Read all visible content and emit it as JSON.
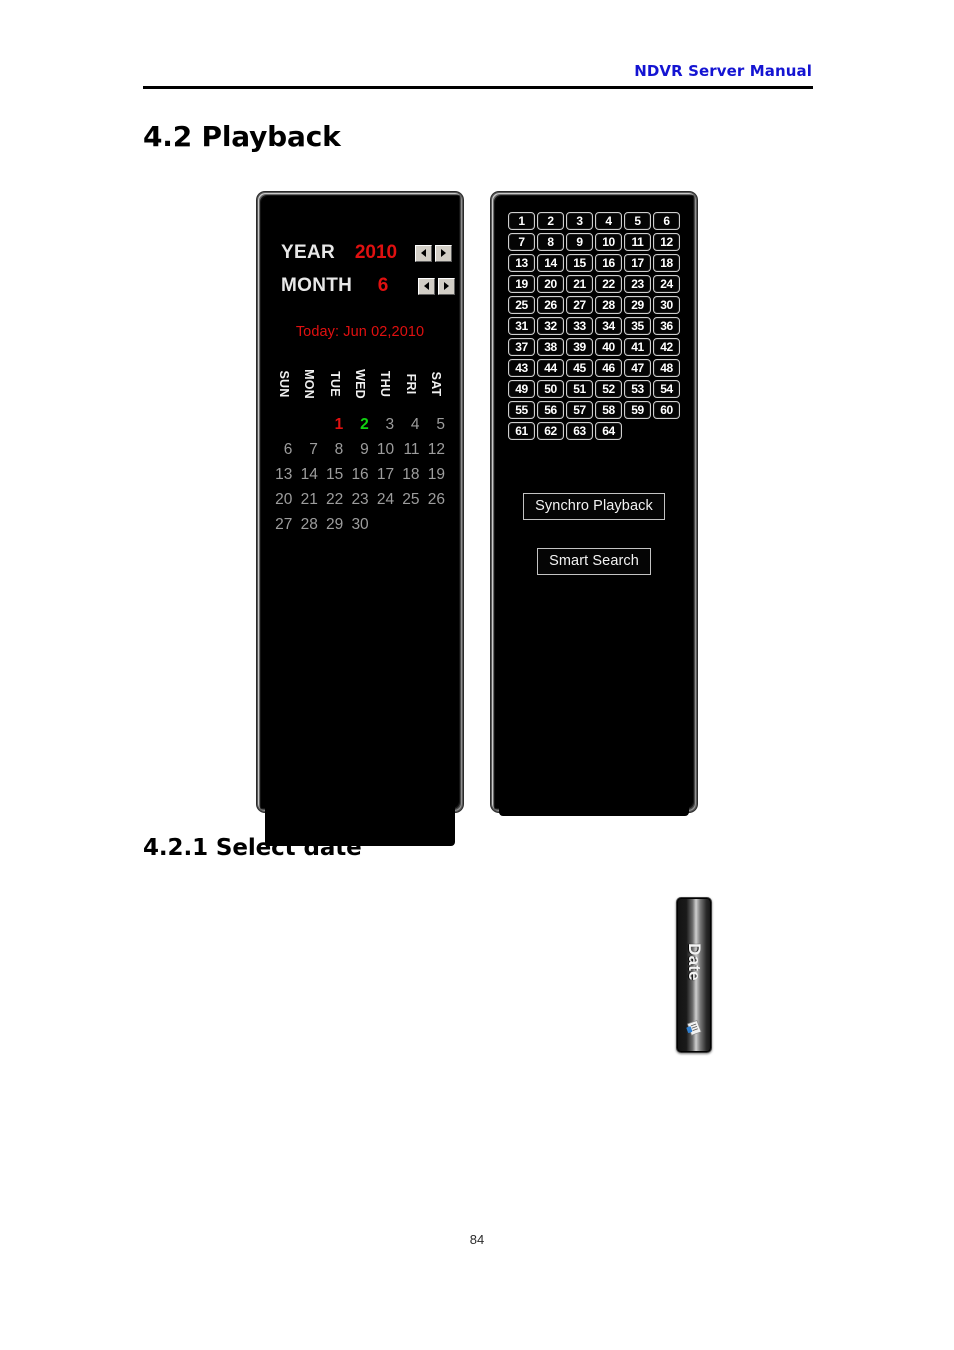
{
  "document": {
    "header_title": "NDVR Server Manual",
    "page_number": "84",
    "section_title": "4.2 Playback",
    "subsection_title": "4.2.1 Select date"
  },
  "calendar_panel": {
    "year_label": "YEAR",
    "year_value": "2010",
    "month_label": "MONTH",
    "month_value": "6",
    "today_text": "Today: Jun 02,2010",
    "prev_icon": "triangle-left-icon",
    "next_icon": "triangle-right-icon",
    "day_headers": [
      "SUN",
      "MON",
      "TUE",
      "WED",
      "THU",
      "FRI",
      "SAT"
    ],
    "weeks": [
      [
        "",
        "",
        "1",
        "2",
        "3",
        "4",
        "5"
      ],
      [
        "6",
        "7",
        "8",
        "9",
        "10",
        "11",
        "12"
      ],
      [
        "13",
        "14",
        "15",
        "16",
        "17",
        "18",
        "19"
      ],
      [
        "20",
        "21",
        "22",
        "23",
        "24",
        "25",
        "26"
      ],
      [
        "27",
        "28",
        "29",
        "30",
        "",
        "",
        ""
      ]
    ],
    "today_day": "1",
    "selected_day": "2",
    "colors": {
      "today": "#e01010",
      "selected": "#11d411",
      "normal": "#9d9d9d",
      "label": "#e8e8e8",
      "value": "#e01010",
      "background": "#000000"
    }
  },
  "channel_panel": {
    "channels": [
      "1",
      "2",
      "3",
      "4",
      "5",
      "6",
      "7",
      "8",
      "9",
      "10",
      "11",
      "12",
      "13",
      "14",
      "15",
      "16",
      "17",
      "18",
      "19",
      "20",
      "21",
      "22",
      "23",
      "24",
      "25",
      "26",
      "27",
      "28",
      "29",
      "30",
      "31",
      "32",
      "33",
      "34",
      "35",
      "36",
      "37",
      "38",
      "39",
      "40",
      "41",
      "42",
      "43",
      "44",
      "45",
      "46",
      "47",
      "48",
      "49",
      "50",
      "51",
      "52",
      "53",
      "54",
      "55",
      "56",
      "57",
      "58",
      "59",
      "60",
      "61",
      "62",
      "63",
      "64"
    ],
    "synchro_playback_label": "Synchro Playback",
    "smart_search_label": "Smart Search"
  },
  "date_tab": {
    "label": "Date",
    "icon": "calendar-page-icon"
  }
}
